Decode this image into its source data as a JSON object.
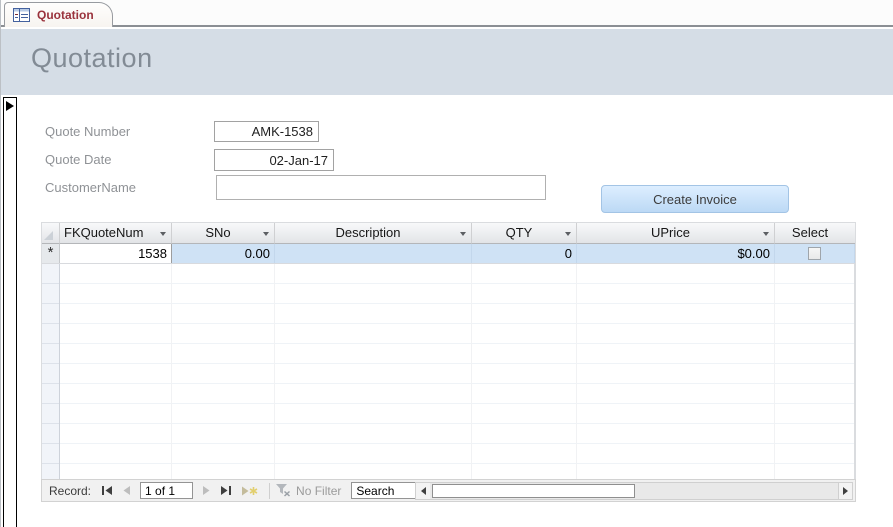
{
  "window": {
    "tab_label": "Quotation"
  },
  "header": {
    "title": "Quotation"
  },
  "form": {
    "fields": [
      {
        "label": "Quote Number",
        "value": "AMK-1538"
      },
      {
        "label": "Quote Date",
        "value": "02-Jan-17"
      },
      {
        "label": "CustomerName",
        "value": ""
      }
    ],
    "create_invoice_label": "Create Invoice"
  },
  "datasheet": {
    "columns": [
      {
        "label": "FKQuoteNum"
      },
      {
        "label": "SNo"
      },
      {
        "label": "Description"
      },
      {
        "label": "QTY"
      },
      {
        "label": "UPrice"
      },
      {
        "label": "Select"
      }
    ],
    "new_row": {
      "symbol": "*",
      "fkquotenum": "1538",
      "sno": "0.00",
      "description": "",
      "qty": "0",
      "uprice": "$0.00",
      "select_checked": false
    }
  },
  "record_nav": {
    "label": "Record:",
    "position": "1 of 1",
    "no_filter_label": "No Filter",
    "search_placeholder": "Search"
  },
  "colors": {
    "header_band": "#d5dde6",
    "row_highlight": "#cfe2f5",
    "button_fill": "#c7def5",
    "tab_text": "#9a323c"
  }
}
